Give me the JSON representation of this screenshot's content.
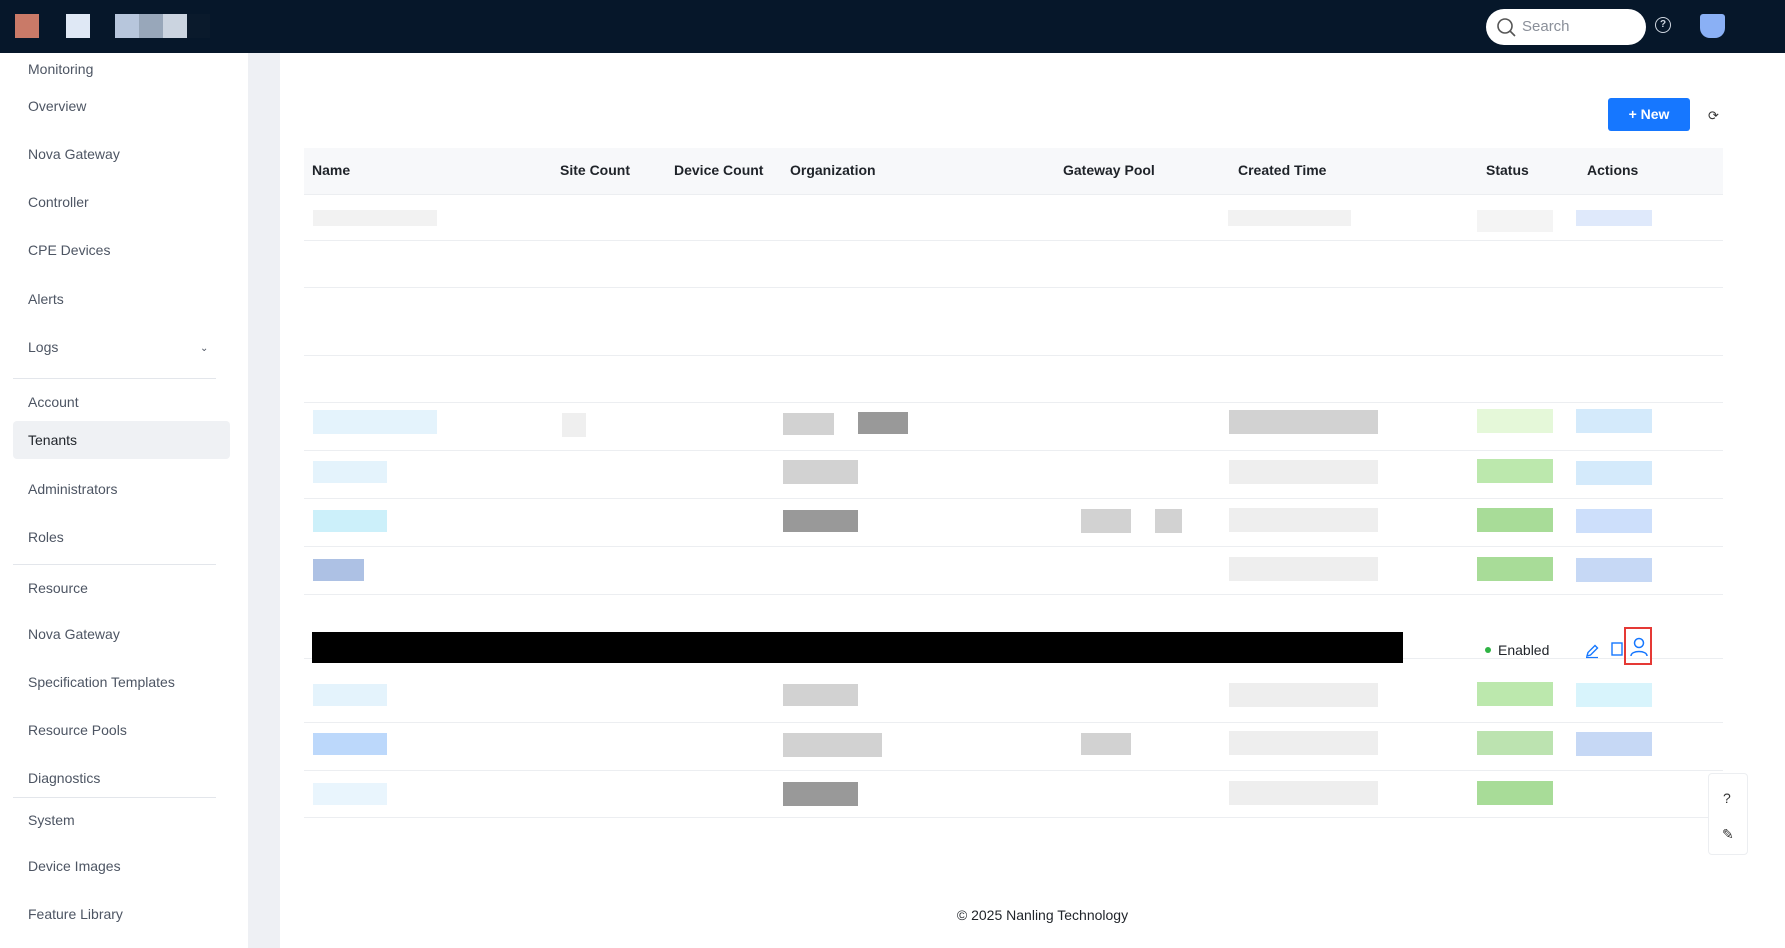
{
  "topbar": {
    "search_placeholder": "Search",
    "help_glyph": "?",
    "icons": [
      "search-icon",
      "help-icon",
      "user-avatar"
    ]
  },
  "sidebar": {
    "monitoring_label": "Monitoring",
    "monitoring_items": [
      "Overview",
      "Nova Gateway",
      "Controller",
      "CPE Devices",
      "Alerts",
      "Logs"
    ],
    "account_label": "Account",
    "account_items": [
      "Tenants",
      "Administrators",
      "Roles"
    ],
    "resource_label": "Resource",
    "resource_items": [
      "Nova Gateway",
      "Specification Templates",
      "Resource Pools",
      "Diagnostics"
    ],
    "system_label": "System",
    "system_items": [
      "Device Images",
      "Feature Library"
    ],
    "active_item": "Tenants"
  },
  "toolbar": {
    "new_label": "+ New",
    "refresh_glyph": "⟳"
  },
  "table": {
    "columns": [
      "Name",
      "Site Count",
      "Device Count",
      "Organization",
      "Gateway Pool",
      "Created Time",
      "Status",
      "Actions"
    ],
    "visible_row": {
      "status": "Enabled",
      "actions": [
        "edit-icon",
        "copy-icon",
        "user-icon"
      ]
    }
  },
  "float_panel": {
    "help_glyph": "?",
    "edit_glyph": "✎"
  },
  "footer": {
    "text": "© 2025 Nanling Technology"
  },
  "colors": {
    "topbar": "#06172a",
    "primary": "#1677ff",
    "status_green": "#2fb344",
    "highlight_red": "#e53935"
  }
}
